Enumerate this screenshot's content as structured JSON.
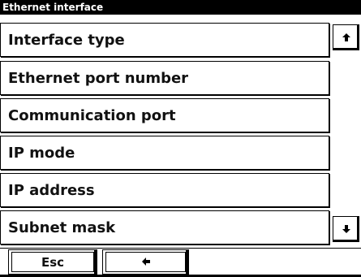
{
  "window": {
    "title": "Ethernet interface"
  },
  "menu": {
    "items": [
      {
        "label": "Interface type"
      },
      {
        "label": "Ethernet port number"
      },
      {
        "label": "Communication port"
      },
      {
        "label": "IP mode"
      },
      {
        "label": "IP address"
      },
      {
        "label": "Subnet mask"
      }
    ]
  },
  "scroll": {
    "up_icon": "arrow-up-icon",
    "down_icon": "arrow-down-icon"
  },
  "softkeys": {
    "esc_label": "Esc",
    "back_icon": "arrow-left-icon"
  }
}
